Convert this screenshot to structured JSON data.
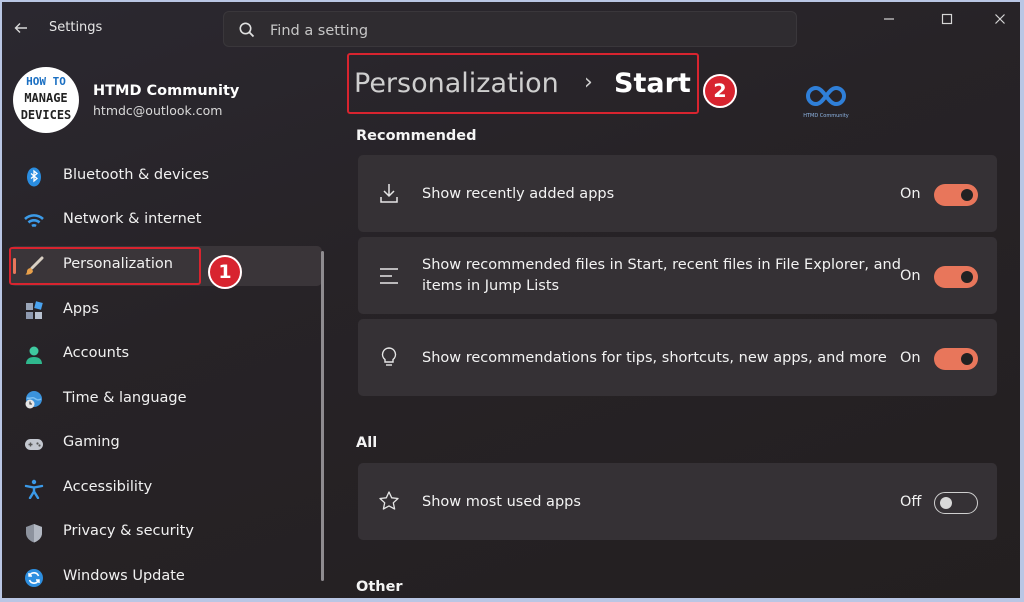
{
  "window": {
    "title": "Settings"
  },
  "search": {
    "placeholder": "Find a setting"
  },
  "profile": {
    "name": "HTMD Community",
    "email": "htmdc@outlook.com",
    "avatar_text": [
      "HOW TO",
      "MANAGE",
      "DEVICES"
    ]
  },
  "sidebar": {
    "items": [
      {
        "label": "Bluetooth & devices",
        "icon": "bluetooth-icon"
      },
      {
        "label": "Network & internet",
        "icon": "wifi-icon"
      },
      {
        "label": "Personalization",
        "icon": "paintbrush-icon",
        "selected": true
      },
      {
        "label": "Apps",
        "icon": "apps-icon"
      },
      {
        "label": "Accounts",
        "icon": "person-icon"
      },
      {
        "label": "Time & language",
        "icon": "globe-clock-icon"
      },
      {
        "label": "Gaming",
        "icon": "gamepad-icon"
      },
      {
        "label": "Accessibility",
        "icon": "accessibility-icon"
      },
      {
        "label": "Privacy & security",
        "icon": "shield-icon"
      },
      {
        "label": "Windows Update",
        "icon": "update-icon"
      }
    ]
  },
  "breadcrumb": {
    "parent": "Personalization",
    "separator": "›",
    "current": "Start"
  },
  "logo": {
    "text": "HTMD Community"
  },
  "annotations": {
    "badge1": "1",
    "badge2": "2"
  },
  "sections": {
    "recommended": {
      "title": "Recommended",
      "items": [
        {
          "label": "Show recently added apps",
          "state": "On",
          "on": true,
          "icon": "download-icon"
        },
        {
          "label_line1": "Show recommended files in Start, recent files in File Explorer, and",
          "label_line2": "items in Jump Lists",
          "state": "On",
          "on": true,
          "icon": "list-icon"
        },
        {
          "label": "Show recommendations for tips, shortcuts, new apps, and more",
          "state": "On",
          "on": true,
          "icon": "lightbulb-icon"
        }
      ]
    },
    "all": {
      "title": "All",
      "items": [
        {
          "label": "Show most used apps",
          "state": "Off",
          "on": false,
          "icon": "star-icon"
        }
      ]
    },
    "other": {
      "title": "Other"
    }
  },
  "colors": {
    "accent": "#e8765b",
    "callout": "#d8242f",
    "background": "#272327",
    "card": "#353135"
  }
}
